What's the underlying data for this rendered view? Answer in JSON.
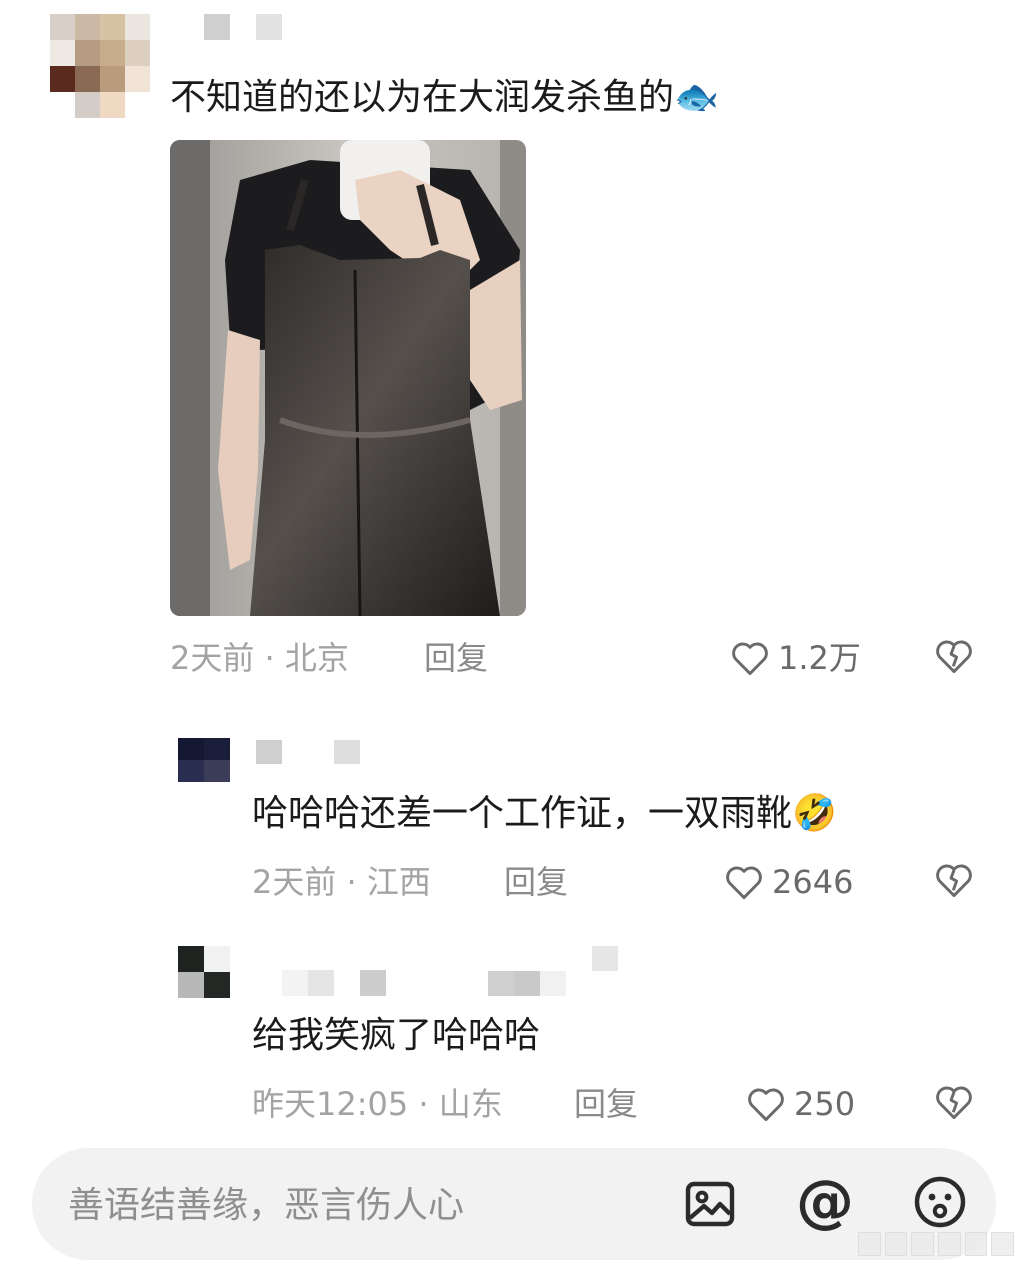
{
  "comments": [
    {
      "text": "不知道的还以为在大润发杀鱼的",
      "emoji": "🐟",
      "meta": "2天前 · 北京",
      "reply_label": "回复",
      "likes": "1.2万",
      "icons": {
        "like": "heart-outline-icon",
        "dislike": "broken-heart-icon"
      }
    },
    {
      "text": "哈哈哈还差一个工作证，一双雨靴",
      "emoji": "🤣",
      "meta": "2天前 · 江西",
      "reply_label": "回复",
      "likes": "2646",
      "icons": {
        "like": "heart-outline-icon",
        "dislike": "broken-heart-icon"
      }
    },
    {
      "text": "给我笑疯了哈哈哈",
      "meta": "昨天12:05 · 山东",
      "reply_label": "回复",
      "likes": "250",
      "icons": {
        "like": "heart-outline-icon",
        "dislike": "broken-heart-icon"
      }
    }
  ],
  "input_bar": {
    "placeholder": "善语结善缘，恶言伤人心",
    "icons": [
      "image-icon",
      "mention-icon",
      "emoji-icon"
    ],
    "mention_symbol": "@"
  },
  "colors": {
    "text": "#1b1b1b",
    "meta": "#a3a3a3",
    "icon": "#6a6a6a",
    "input_bg": "#f2f2f2"
  }
}
